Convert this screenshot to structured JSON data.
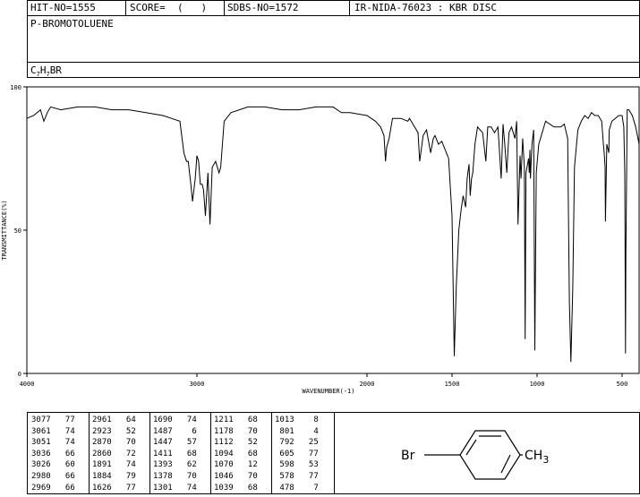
{
  "header": {
    "hit_no": "HIT-NO=1555",
    "score": "SCORE=  (   )",
    "sdbs_no": "SDBS-NO=1572",
    "ir_code": "IR-NIDA-76023 : KBR DISC",
    "compound_name": "P-BROMOTOLUENE",
    "formula_parts": [
      "C",
      "7",
      "H",
      "7",
      "BR"
    ]
  },
  "chart_data": {
    "type": "line",
    "title": "",
    "xlabel": "WAVENUMBER(-1)",
    "ylabel": "TRANSMITTANCE(%)",
    "xlim": [
      4000,
      400
    ],
    "ylim": [
      0,
      100
    ],
    "x_ticks": [
      4000,
      3000,
      2000,
      1500,
      1000,
      500
    ],
    "y_ticks": [
      0,
      50,
      100
    ],
    "x_tick_labels": [
      "4000",
      "3000",
      "2000",
      "1500",
      "1000",
      "500"
    ],
    "y_tick_labels": [
      "0",
      "50",
      "100"
    ],
    "grid": false,
    "series": [
      {
        "x": [
          4000,
          3960,
          3920,
          3900,
          3880,
          3860,
          3800,
          3700,
          3600,
          3500,
          3400,
          3300,
          3200,
          3150,
          3100,
          3077,
          3061,
          3051,
          3036,
          3026,
          3010,
          3000,
          2990,
          2980,
          2969,
          2961,
          2950,
          2935,
          2923,
          2910,
          2890,
          2870,
          2860,
          2840,
          2800,
          2700,
          2600,
          2500,
          2400,
          2300,
          2200,
          2150,
          2100,
          2000,
          1950,
          1920,
          1900,
          1891,
          1884,
          1870,
          1850,
          1800,
          1760,
          1750,
          1720,
          1700,
          1690,
          1670,
          1650,
          1626,
          1610,
          1600,
          1580,
          1560,
          1540,
          1520,
          1500,
          1487,
          1475,
          1460,
          1447,
          1435,
          1420,
          1411,
          1400,
          1393,
          1385,
          1378,
          1365,
          1350,
          1320,
          1301,
          1290,
          1270,
          1250,
          1240,
          1230,
          1211,
          1200,
          1190,
          1178,
          1165,
          1150,
          1130,
          1120,
          1112,
          1100,
          1094,
          1085,
          1075,
          1070,
          1065,
          1050,
          1046,
          1042,
          1039,
          1030,
          1020,
          1013,
          1005,
          990,
          950,
          900,
          860,
          840,
          820,
          810,
          801,
          790,
          780,
          760,
          740,
          720,
          700,
          680,
          660,
          640,
          620,
          610,
          605,
          600,
          598,
          590,
          578,
          576,
          560,
          540,
          520,
          500,
          490,
          484,
          480,
          478,
          470,
          460,
          440,
          420,
          400
        ],
        "y": [
          89,
          90,
          92,
          88,
          91,
          93,
          92,
          93,
          93,
          92,
          92,
          91,
          90,
          89,
          88,
          77,
          74,
          74,
          66,
          60,
          68,
          76,
          74,
          66,
          66,
          64,
          55,
          70,
          52,
          72,
          74,
          70,
          72,
          88,
          91,
          93,
          93,
          92,
          92,
          93,
          93,
          91,
          91,
          90,
          88,
          86,
          83,
          74,
          79,
          82,
          89,
          89,
          88,
          89,
          86,
          84,
          74,
          83,
          85,
          77,
          82,
          83,
          80,
          81,
          78,
          75,
          55,
          6,
          30,
          50,
          57,
          62,
          58,
          68,
          73,
          62,
          68,
          70,
          80,
          86,
          84,
          74,
          86,
          86,
          84,
          85,
          86,
          68,
          87,
          80,
          70,
          84,
          86,
          82,
          88,
          52,
          76,
          68,
          82,
          72,
          12,
          70,
          75,
          70,
          78,
          68,
          80,
          85,
          8,
          70,
          80,
          88,
          86,
          86,
          87,
          82,
          25,
          4,
          30,
          72,
          85,
          88,
          90,
          89,
          91,
          90,
          90,
          88,
          80,
          77,
          72,
          53,
          80,
          77,
          85,
          88,
          89,
          90,
          90,
          86,
          70,
          7,
          40,
          92,
          92,
          90,
          86,
          80
        ]
      }
    ]
  },
  "peak_table": {
    "columns": [
      [
        [
          "3077",
          "77"
        ],
        [
          "3061",
          "74"
        ],
        [
          "3051",
          "74"
        ],
        [
          "3036",
          "66"
        ],
        [
          "3026",
          "60"
        ],
        [
          "2980",
          "66"
        ],
        [
          "2969",
          "66"
        ]
      ],
      [
        [
          "2961",
          "64"
        ],
        [
          "2923",
          "52"
        ],
        [
          "2870",
          "70"
        ],
        [
          "2860",
          "72"
        ],
        [
          "1891",
          "74"
        ],
        [
          "1884",
          "79"
        ],
        [
          "1626",
          "77"
        ]
      ],
      [
        [
          "1690",
          "74"
        ],
        [
          "1487",
          "6"
        ],
        [
          "1447",
          "57"
        ],
        [
          "1411",
          "68"
        ],
        [
          "1393",
          "62"
        ],
        [
          "1378",
          "70"
        ],
        [
          "1301",
          "74"
        ]
      ],
      [
        [
          "1211",
          "68"
        ],
        [
          "1178",
          "70"
        ],
        [
          "1112",
          "52"
        ],
        [
          "1094",
          "68"
        ],
        [
          "1070",
          "12"
        ],
        [
          "1046",
          "70"
        ],
        [
          "1039",
          "68"
        ]
      ],
      [
        [
          "1013",
          "8"
        ],
        [
          "801",
          "4"
        ],
        [
          "792",
          "25"
        ],
        [
          "605",
          "77"
        ],
        [
          "598",
          "53"
        ],
        [
          "578",
          "77"
        ],
        [
          "478",
          "7"
        ]
      ]
    ]
  },
  "structure": {
    "left_group": "Br",
    "right_group_main": "CH",
    "right_group_sub": "3"
  }
}
